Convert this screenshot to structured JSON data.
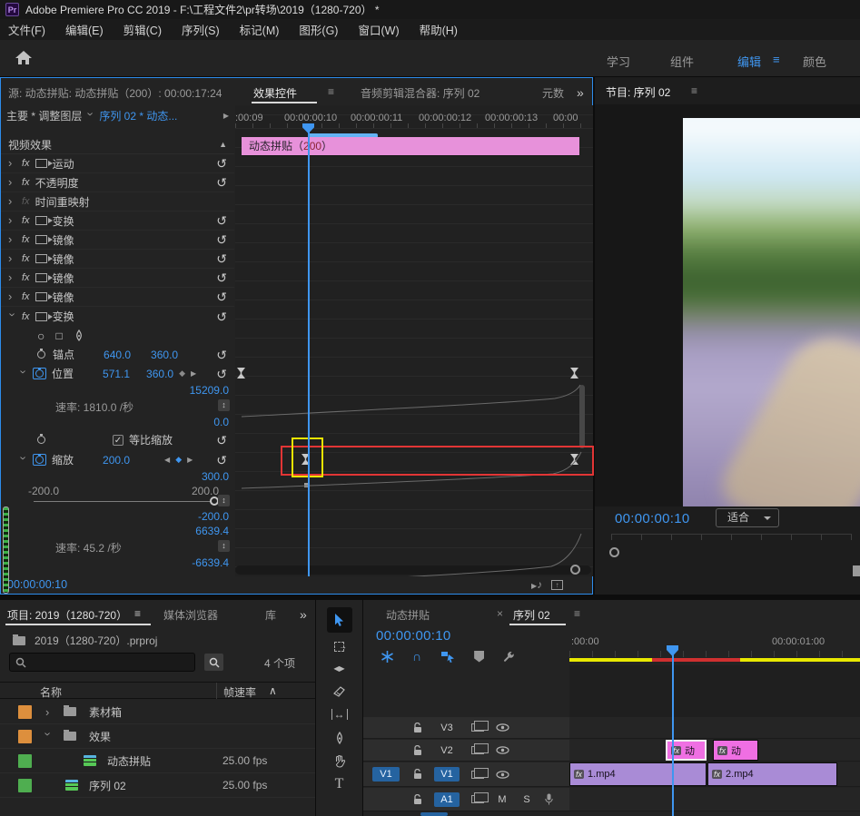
{
  "title_bar": {
    "icon": "Pr",
    "title": "Adobe Premiere Pro CC 2019 - F:\\工程文件2\\pr转场\\2019（1280-720）  *"
  },
  "menu": {
    "items": [
      "文件(F)",
      "编辑(E)",
      "剪辑(C)",
      "序列(S)",
      "标记(M)",
      "图形(G)",
      "窗口(W)",
      "帮助(H)"
    ]
  },
  "workspace": {
    "tabs": [
      {
        "label": "学习"
      },
      {
        "label": "组件"
      },
      {
        "label": "编辑"
      },
      {
        "label": "颜色"
      }
    ]
  },
  "icons": {
    "menu": "≡",
    "overflow": "»",
    "chevron": "›",
    "collapse": "▲",
    "reset": "↺",
    "play_left": "◀",
    "play_right": "▶",
    "diamond": "◆",
    "check": "✓",
    "updown": "↕",
    "ellipse": "○",
    "rect": "□",
    "close": "×",
    "sort_up": "∧",
    "note": "♪",
    "arrow_up": "↑",
    "magnet": "∩",
    "arrow_lr": "↔",
    "fx": "fx",
    "type_t": "T"
  },
  "effect_controls": {
    "tab_source": "源: 动态拼贴: 动态拼贴（200）: 00:00:17:24",
    "tab_effects": "效果控件",
    "tab_mixer": "音频剪辑混合器: 序列 02",
    "tab_metadata": "元数",
    "master_label": "主要 * 调整图层",
    "sequence_label": "序列 02 * 动态...",
    "ruler_ticks": [
      ":00:09",
      "00:00:00:10",
      "00:00:00:11",
      "00:00:00:12",
      "00:00:00:13",
      "00:00"
    ],
    "clip_bar_prefix": "动态拼贴（",
    "clip_bar_num": "200",
    "clip_bar_suffix": "）",
    "header": "视频效果",
    "effects": [
      {
        "name": "运动"
      },
      {
        "name": "不透明度"
      },
      {
        "name": "时间重映射"
      },
      {
        "name": "变换"
      },
      {
        "name": "镜像"
      },
      {
        "name": "镜像"
      },
      {
        "name": "镜像"
      },
      {
        "name": "镜像"
      },
      {
        "name": "变换"
      }
    ],
    "anchor": {
      "label": "锚点",
      "x": "640.0",
      "y": "360.0"
    },
    "position": {
      "label": "位置",
      "x": "571.1",
      "y": "360.0"
    },
    "pos_graph": {
      "max": "15209.0",
      "rate": "速率: 1810.0 /秒",
      "min": "0.0"
    },
    "uniform_scale_label": "等比缩放",
    "scale": {
      "label": "缩放",
      "value": "200.0"
    },
    "scale_graph": {
      "max": "300.0",
      "slider_min": "-200.0",
      "slider_max": "200.0",
      "min": "-200.0"
    },
    "velocity_graph": {
      "max": "6639.4",
      "rate": "速率: 45.2 /秒",
      "min": "-6639.4"
    },
    "timecode": "00:00:00:10"
  },
  "program": {
    "tab": "节目: 序列 02",
    "timecode": "00:00:00:10",
    "fit": "适合"
  },
  "project": {
    "tab_project": "项目: 2019（1280-720）",
    "tab_media": "媒体浏览器",
    "tab_libraries": "库",
    "breadcrumb": "2019（1280-720）.prproj",
    "count": "4 个项",
    "col_name": "名称",
    "col_fps": "帧速率",
    "items": [
      {
        "name": "素材箱",
        "fps": ""
      },
      {
        "name": "效果",
        "fps": ""
      },
      {
        "name": "动态拼贴",
        "fps": "25.00 fps"
      },
      {
        "name": "序列 02",
        "fps": "25.00 fps"
      }
    ]
  },
  "timeline": {
    "tab_inactive": "动态拼贴",
    "tab_active": "序列 02",
    "timecode": "00:00:00:10",
    "ruler_start": ":00:00",
    "ruler_end": "00:00:01:00",
    "tracks": {
      "v3": "V3",
      "v2": "V2",
      "v1": "V1",
      "a1": "A1"
    },
    "v1_patch": "V1",
    "a1_buttons": {
      "mute": "M",
      "solo": "S"
    },
    "clips": {
      "v2a": "动",
      "v2b": "动",
      "v1a": "1.mp4",
      "v1b": "2.mp4"
    }
  },
  "colors": {
    "accent_blue": "#3f96f0",
    "panel_border_blue": "#2d8ceb",
    "clip_pink": "#ef6fe3",
    "clip_purple": "#a98bd6",
    "effect_clip_pink": "#e791da",
    "bin_orange": "#dd8f3d",
    "seq_green": "#4fae50",
    "workarea_yellow": "#e8e800",
    "workarea_red": "#d03030",
    "track_patch_blue": "#2563a0"
  }
}
